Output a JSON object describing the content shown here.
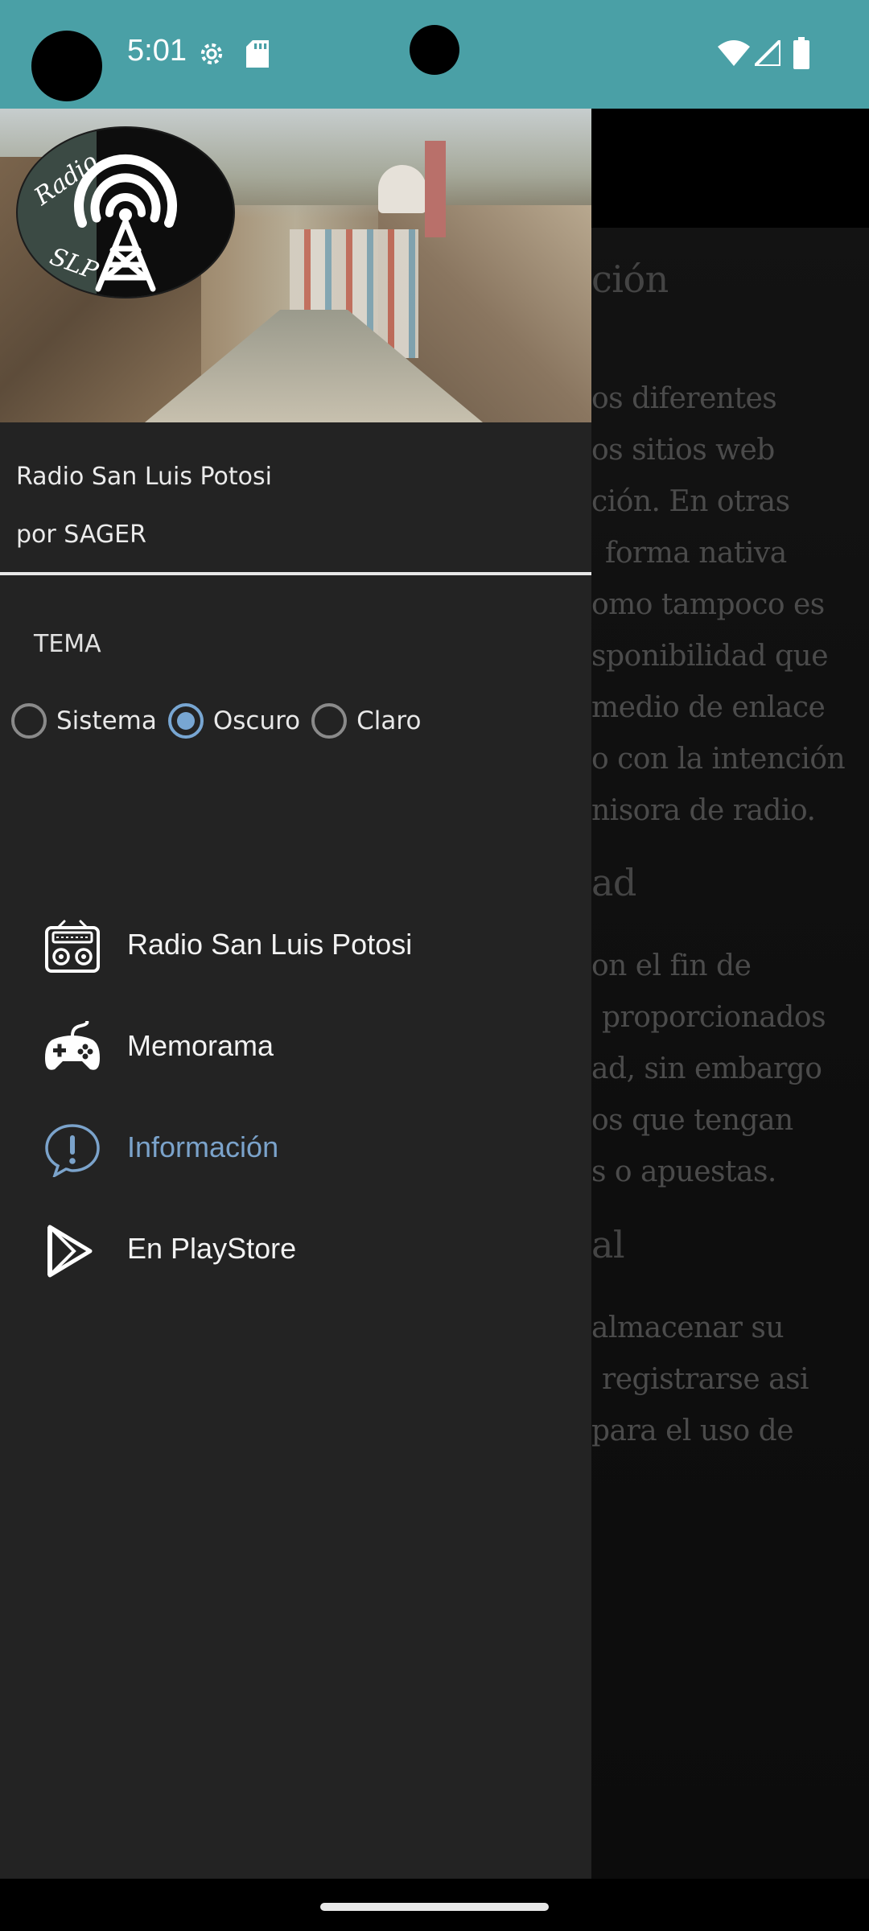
{
  "status_bar": {
    "time": "5:01",
    "icons": [
      "settings-gear-icon",
      "sd-card-icon",
      "wifi-icon",
      "signal-icon",
      "battery-icon"
    ],
    "color": "#4aa0a6"
  },
  "background_page": {
    "heading_1": "ción",
    "lines_1": [
      "os diferentes",
      "os sitios web",
      "ción. En otras",
      "forma nativa",
      "omo tampoco es",
      "sponibilidad que",
      "medio de enlace",
      "o con la intención",
      "nisora de radio."
    ],
    "heading_2": "ad",
    "lines_2": [
      "on el fin de",
      "proporcionados",
      "ad, sin embargo",
      "os que tengan",
      "s o apuestas."
    ],
    "heading_3": "al",
    "lines_3": [
      "almacenar su",
      "registrarse asi",
      "para el uso de"
    ]
  },
  "drawer": {
    "app_title": "Radio San Luis Potosi",
    "app_subtitle": "por SAGER",
    "logo_text_top": "Radio",
    "logo_text_bottom": "SLP",
    "theme": {
      "label": "TEMA",
      "options": [
        {
          "label": "Sistema",
          "selected": false
        },
        {
          "label": "Oscuro",
          "selected": true
        },
        {
          "label": "Claro",
          "selected": false
        }
      ]
    },
    "menu": [
      {
        "label": "Radio San Luis Potosi",
        "icon": "radio-icon",
        "active": false
      },
      {
        "label": "Memorama",
        "icon": "gamepad-icon",
        "active": false
      },
      {
        "label": "Información",
        "icon": "info-chat-icon",
        "active": true
      },
      {
        "label": "En PlayStore",
        "icon": "play-store-icon",
        "active": false
      }
    ],
    "accent_color": "#7ba3cb"
  }
}
